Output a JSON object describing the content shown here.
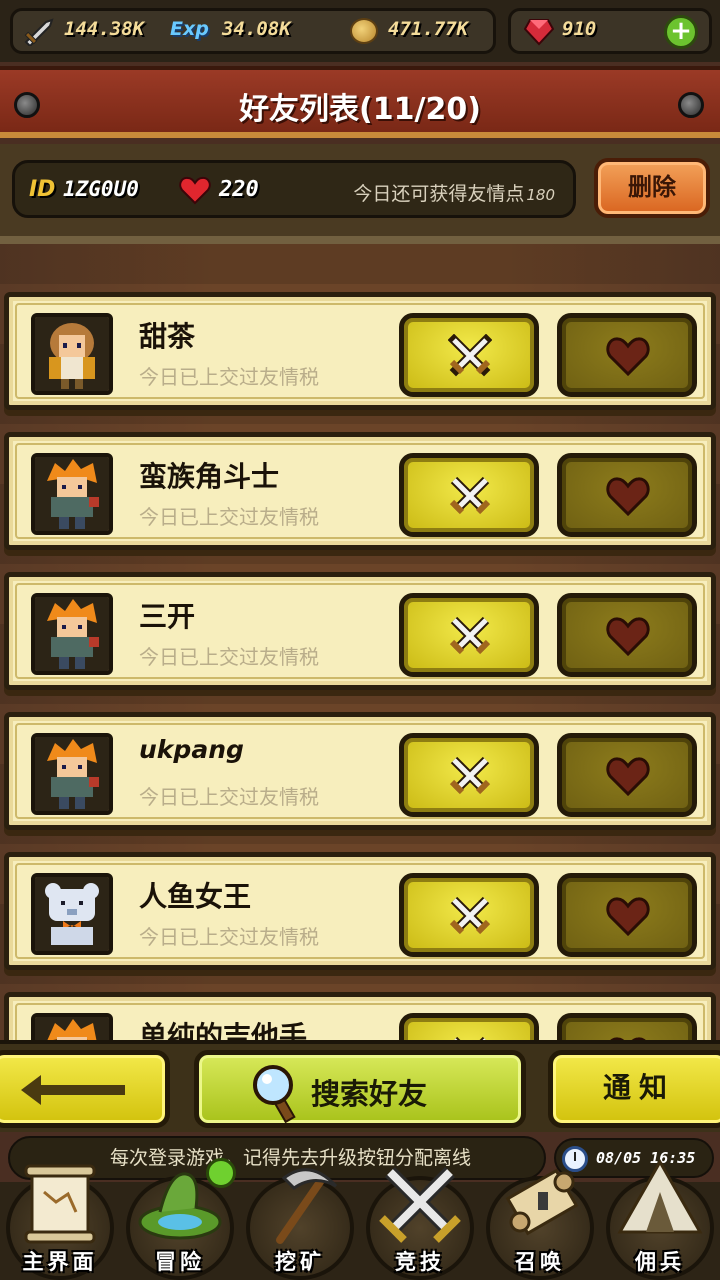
{
  "resources": {
    "attack": "144.38K",
    "exp_label": "Exp",
    "exp": "34.08K",
    "gold": "471.77K",
    "gems": "910"
  },
  "title": "好友列表(11/20)",
  "info": {
    "id_label": "ID",
    "id_value": "1ZG0U0",
    "hearts": "220",
    "points_text": "今日还可获得友情点",
    "points_value": "180",
    "delete_label": "删除"
  },
  "friends": [
    {
      "name": "甜茶",
      "status": "今日已上交过友情税",
      "avatar": "girl-avatar"
    },
    {
      "name": "蛮族角斗士",
      "status": "今日已上交过友情税",
      "avatar": "warrior-avatar"
    },
    {
      "name": "三开",
      "status": "今日已上交过友情税",
      "avatar": "warrior-avatar"
    },
    {
      "name": "ukpang",
      "status": "今日已上交过友情税",
      "avatar": "warrior-avatar"
    },
    {
      "name": "人鱼女王",
      "status": "今日已上交过友情税",
      "avatar": "bear-avatar"
    },
    {
      "name": "单纯的吉他手",
      "status": "",
      "avatar": "warrior-avatar"
    }
  ],
  "actions": {
    "search_label": "搜索好友",
    "notify_label": "通知"
  },
  "ticker": "每次登录游戏，记得先去升级按钮分配离线",
  "datetime": "08/05 16:35",
  "nav": [
    {
      "label": "主界面",
      "icon": "map-scroll-icon"
    },
    {
      "label": "冒险",
      "icon": "island-icon"
    },
    {
      "label": "挖矿",
      "icon": "pickaxe-icon"
    },
    {
      "label": "竞技",
      "icon": "crossed-swords-icon"
    },
    {
      "label": "召唤",
      "icon": "scroll-icon"
    },
    {
      "label": "佣兵",
      "icon": "tent-icon"
    }
  ],
  "colors": {
    "accent_yellow": "#f2e94a",
    "banner_red": "#9b3a26",
    "delete_orange": "#e8823a",
    "row_bg": "#f7eebd"
  }
}
